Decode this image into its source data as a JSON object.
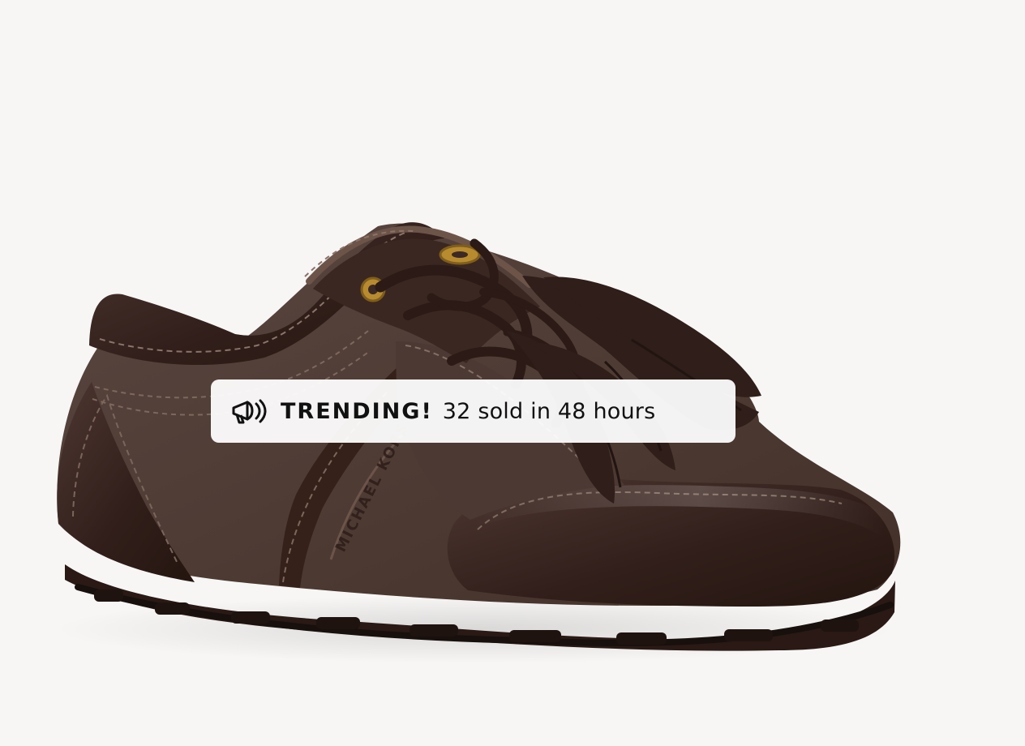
{
  "badge": {
    "icon": "megaphone-icon",
    "highlight": "TRENDING!",
    "message": "32 sold in 48 hours"
  },
  "colors": {
    "background": "#f7f6f5",
    "shoe": "#3b2925",
    "accent": "#b88b2f"
  }
}
